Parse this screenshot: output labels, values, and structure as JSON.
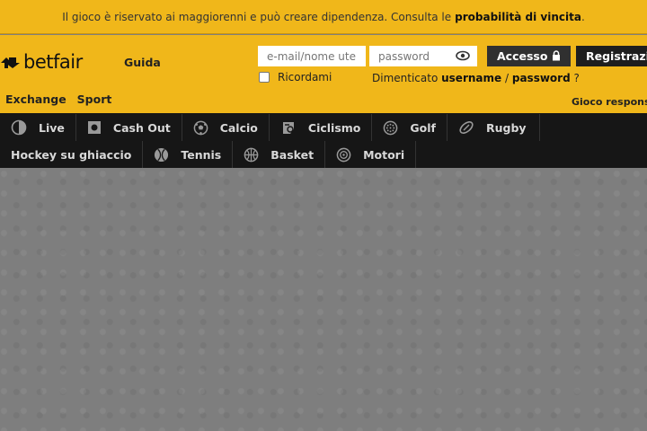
{
  "banner": {
    "text": "Il gioco è riservato ai maggiorenni e può creare dipendenza. Consulta le",
    "link": "probabilità di vincita",
    "end": "."
  },
  "header": {
    "logo": "betfair",
    "guida": "Guida",
    "email_placeholder": "e-mail/nome utente",
    "password_placeholder": "password",
    "login_label": "Accesso",
    "register_label": "Registrazione",
    "remember_label": "Ricordami",
    "forgot_prefix": "Dimenticato",
    "forgot_username": "username",
    "forgot_sep": "/",
    "forgot_password": "password",
    "forgot_suffix": "?",
    "tabs": [
      "Exchange",
      "Sport"
    ],
    "responsible": "Gioco responsabile"
  },
  "sports": {
    "row1": [
      {
        "label": "Live",
        "icon": "live-icon"
      },
      {
        "label": "Cash Out",
        "icon": "cash-out-icon"
      },
      {
        "label": "Calcio",
        "icon": "soccer-ball-icon"
      },
      {
        "label": "Ciclismo",
        "icon": "cycling-icon"
      },
      {
        "label": "Golf",
        "icon": "golf-ball-icon"
      },
      {
        "label": "Rugby",
        "icon": "rugby-ball-icon"
      }
    ],
    "row2": [
      {
        "label": "Hockey su ghiaccio",
        "icon": ""
      },
      {
        "label": "Tennis",
        "icon": "tennis-ball-icon"
      },
      {
        "label": "Basket",
        "icon": "basketball-icon"
      },
      {
        "label": "Motori",
        "icon": "motor-wheel-icon"
      }
    ]
  },
  "colors": {
    "brand": "#f0b71a",
    "nav_bg": "#161616",
    "overlay": "#808080"
  }
}
